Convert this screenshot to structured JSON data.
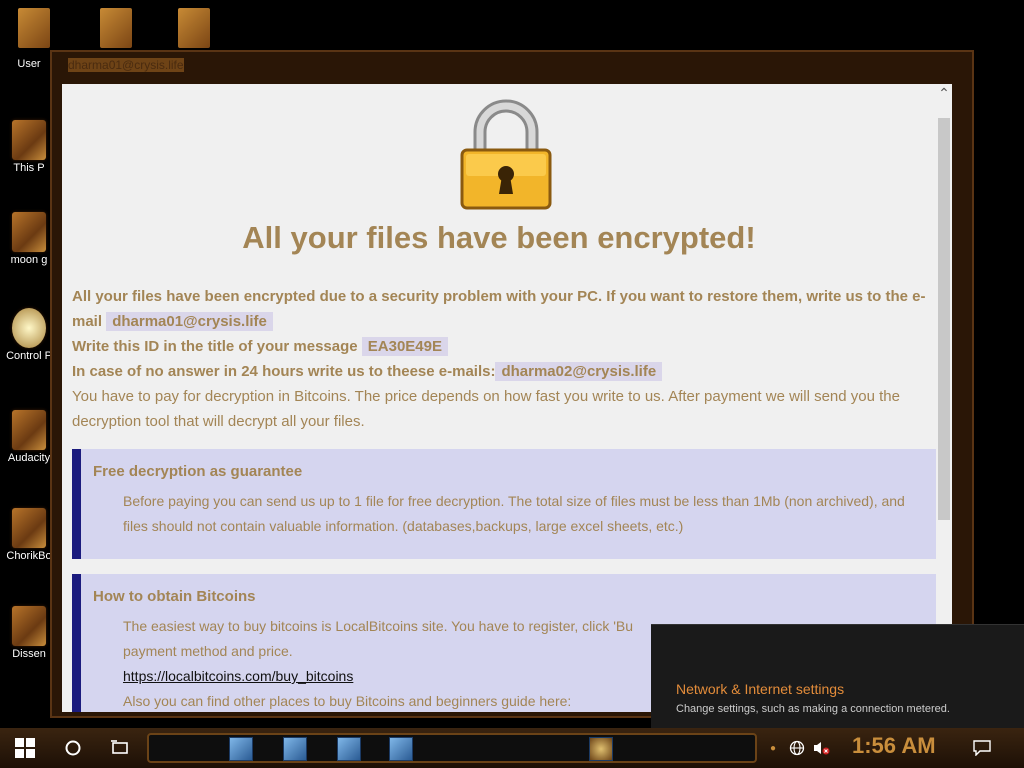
{
  "desktop": {
    "icons": [
      {
        "label": "User"
      },
      {
        "label": "This P"
      },
      {
        "label": "moon g"
      },
      {
        "label": "Control P"
      },
      {
        "label": "Audacity"
      },
      {
        "label": "ChorikBo"
      },
      {
        "label": "Dissen"
      }
    ]
  },
  "window": {
    "title": "dharma01@crysis.life"
  },
  "note": {
    "heading": "All your files have been encrypted!",
    "line1": "All your files have been encrypted due to a security problem with your PC. If you want to restore them, write us to the e-mail",
    "email1": "dharma01@crysis.life",
    "line2": "Write this ID in the title of your message",
    "id": "EA30E49E",
    "line3": "In case of no answer in 24 hours write us to theese e-mails:",
    "email2": "dharma02@crysis.life",
    "line4": "You have to pay for decryption in Bitcoins. The price depends on how fast you write to us. After payment we will send you the decryption tool that will decrypt all your files.",
    "free_title": "Free decryption as guarantee",
    "free_text": "Before paying you can send us up to 1 file for free decryption. The total size of files must be less than 1Mb (non archived), and files should not contain valuable information. (databases,backups, large excel sheets, etc.)",
    "btc_title": "How to obtain Bitcoins",
    "btc_text1": "The easiest way to buy bitcoins is LocalBitcoins site. You have to register, click 'Bu",
    "btc_text2": "payment method and price.",
    "btc_link": "https://localbitcoins.com/buy_bitcoins",
    "btc_text3": "Also you can find other places to buy Bitcoins and beginners guide here:"
  },
  "flyout": {
    "title": "Network & Internet settings",
    "subtitle": "Change settings, such as making a connection metered."
  },
  "taskbar": {
    "clock": "1:56 AM"
  },
  "colors": {
    "text": "#a38555",
    "box_bg": "#d5d5ef",
    "box_border": "#1b1b7e",
    "accent": "#e38c3a"
  }
}
